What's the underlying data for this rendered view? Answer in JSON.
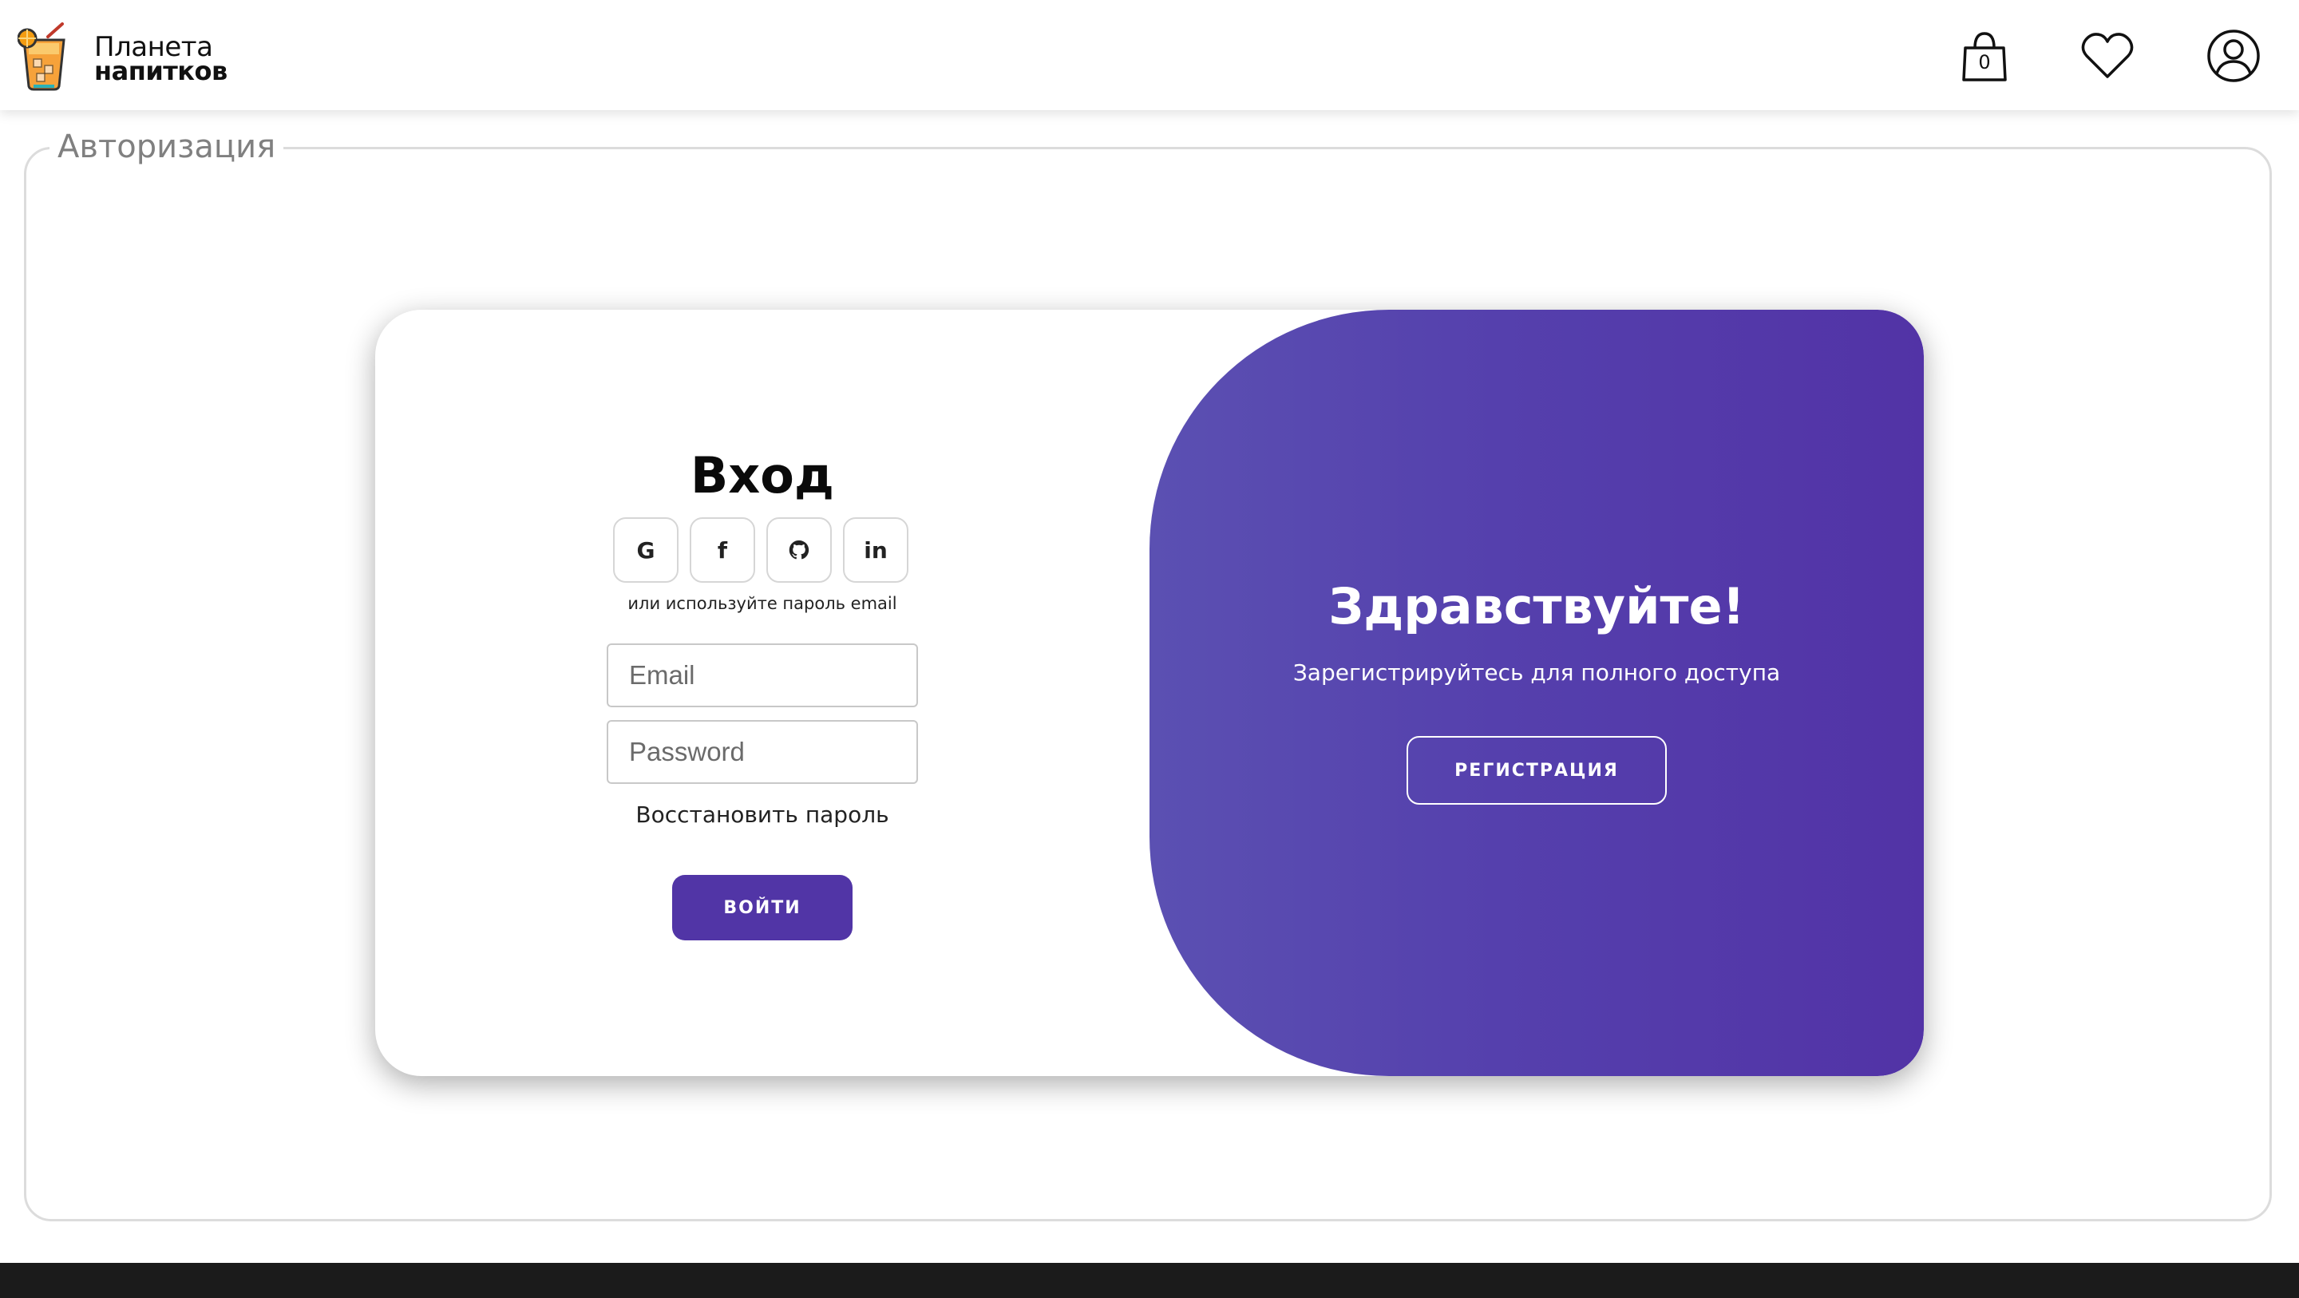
{
  "header": {
    "brand_line1": "Планета",
    "brand_line2": "напитков",
    "cart_count": "0",
    "icons": [
      "cocktail-logo",
      "shopping-bag-icon",
      "heart-icon",
      "user-icon"
    ]
  },
  "section": {
    "legend": "Авторизация"
  },
  "login": {
    "title": "Вход",
    "social": [
      {
        "icon": "google-icon",
        "label": "G"
      },
      {
        "icon": "facebook-icon",
        "label": "f"
      },
      {
        "icon": "github-icon",
        "label": ""
      },
      {
        "icon": "linkedin-icon",
        "label": "in"
      }
    ],
    "alt_text": "или используйте пароль email",
    "email_placeholder": "Email",
    "password_placeholder": "Password",
    "forgot_label": "Восстановить пароль",
    "submit_label": "ВОЙТИ"
  },
  "register_panel": {
    "title": "Здравствуйте!",
    "subtitle": "Зарегистрируйтесь для полного доступа",
    "button_label": "РЕГИСТРАЦИЯ"
  },
  "colors": {
    "accent": "#5135a6",
    "panel_gradient_start": "#5b50b2",
    "panel_gradient_end": "#5233a6",
    "footer": "#1b1b1b"
  }
}
